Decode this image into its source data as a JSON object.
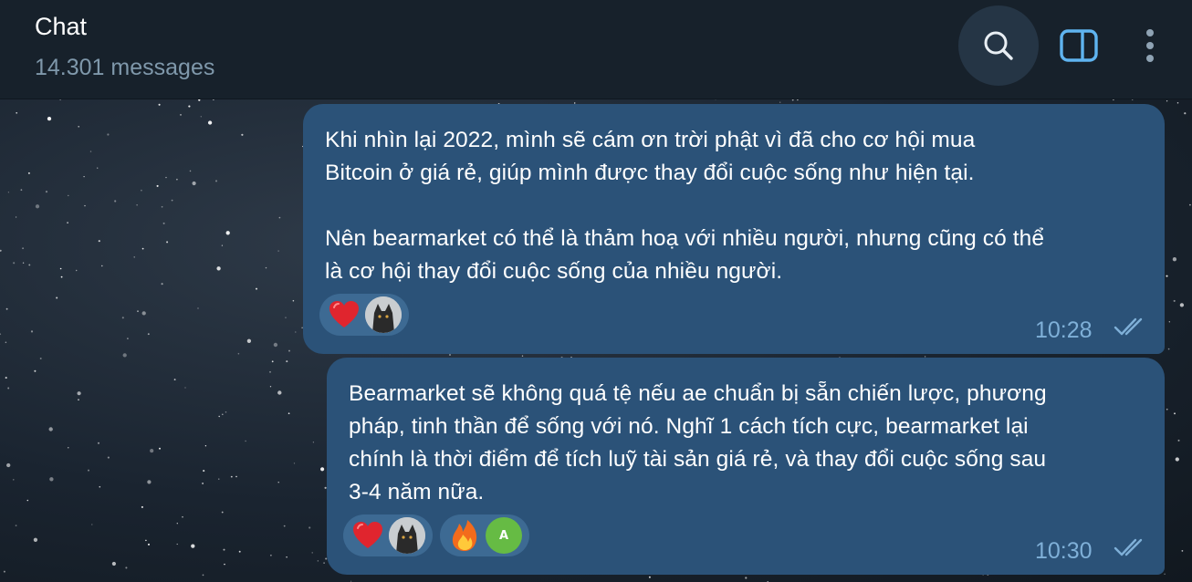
{
  "header": {
    "title": "Chat",
    "subtitle": "14.301 messages",
    "search_icon": "search-icon",
    "panel_icon": "sidebar-toggle-icon",
    "more_icon": "more-vertical-icon"
  },
  "messages": [
    {
      "text": "Khi nhìn lại 2022, mình sẽ cám ơn trời phật vì đã cho cơ hội mua\nBitcoin ở giá rẻ, giúp mình được thay đổi cuộc sống như hiện tại.\n\nNên bearmarket có thể là thảm hoạ với nhiều người, nhưng cũng có thể\nlà cơ hội thay đổi cuộc sống của nhiều người.",
      "time": "10:28",
      "status": "read",
      "reactions": [
        {
          "emoji": "heart-icon",
          "by": "avatar-wolf"
        }
      ]
    },
    {
      "text": "Bearmarket sẽ không quá tệ nếu ae chuẩn bị sẵn chiến lược, phương\npháp, tinh thần để sống với nó. Nghĩ 1 cách tích cực, bearmarket lại\nchính là thời điểm để tích luỹ tài sản giá rẻ, và thay đổi cuộc sống sau\n3-4 năm nữa.",
      "time": "10:30",
      "status": "read",
      "reactions": [
        {
          "emoji": "heart-icon",
          "by": "avatar-wolf"
        },
        {
          "emoji": "fire-icon",
          "by_initial": "A"
        }
      ]
    }
  ],
  "colors": {
    "header_bg": "#17212b",
    "bubble_out": "#2b5278",
    "time": "#7fb0d8",
    "accent": "#5fb4f0"
  }
}
